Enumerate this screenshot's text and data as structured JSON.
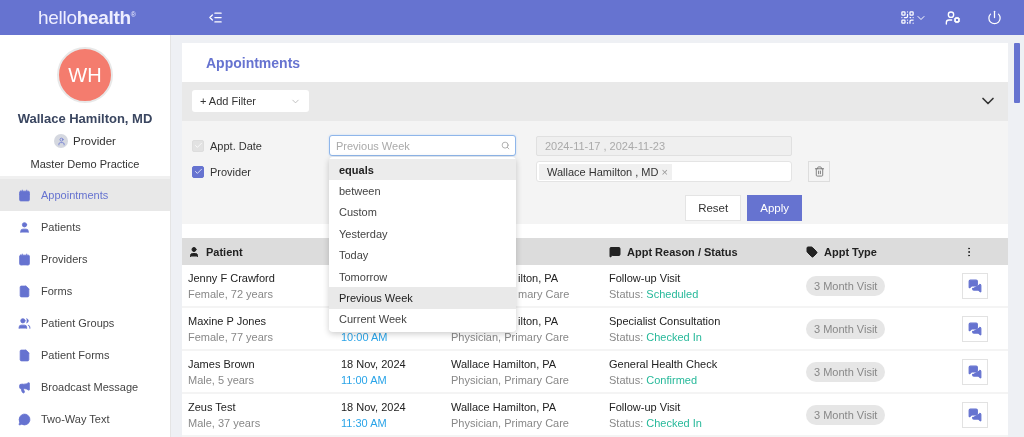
{
  "topbar": {
    "logo_light": "hello",
    "logo_bold": "health",
    "logo_mark": "®"
  },
  "profile": {
    "initials": "WH",
    "name": "Wallace Hamilton, MD",
    "role": "Provider",
    "practice": "Master Demo Practice"
  },
  "sidebar": {
    "items": [
      {
        "label": "Appointments",
        "selected": true
      },
      {
        "label": "Patients",
        "selected": false
      },
      {
        "label": "Providers",
        "selected": false
      },
      {
        "label": "Forms",
        "selected": false
      },
      {
        "label": "Patient Groups",
        "selected": false
      },
      {
        "label": "Patient Forms",
        "selected": false
      },
      {
        "label": "Broadcast Message",
        "selected": false
      },
      {
        "label": "Two-Way Text",
        "selected": false
      }
    ]
  },
  "page_title": "Appointments",
  "filter_bar": {
    "add_filter": "+ Add Filter",
    "expanded": true
  },
  "filters": [
    {
      "label": "Appt. Date",
      "checked": true,
      "disabled": true,
      "operator_placeholder": "Previous Week",
      "value": "2024-11-17 , 2024-11-23"
    },
    {
      "label": "Provider",
      "checked": true,
      "disabled": false,
      "chips": [
        "Wallace Hamilton , MD"
      ],
      "chip_remove": "×"
    }
  ],
  "buttons": {
    "reset": "Reset",
    "apply": "Apply"
  },
  "operator_dropdown": {
    "options": [
      {
        "label": "equals",
        "selected": false,
        "hovered": true
      },
      {
        "label": "between",
        "selected": false,
        "hovered": false
      },
      {
        "label": "Custom",
        "selected": false,
        "hovered": false
      },
      {
        "label": "Yesterday",
        "selected": false,
        "hovered": false
      },
      {
        "label": "Today",
        "selected": false,
        "hovered": false
      },
      {
        "label": "Tomorrow",
        "selected": false,
        "hovered": false
      },
      {
        "label": "Previous Week",
        "selected": true,
        "hovered": false
      },
      {
        "label": "Current Week",
        "selected": false,
        "hovered": false
      }
    ]
  },
  "table": {
    "columns": [
      {
        "label": "Patient"
      },
      {},
      {},
      {
        "label": "Appt Reason / Status"
      },
      {
        "label": "Appt Type"
      }
    ],
    "rows": [
      {
        "kind": "covered",
        "patient": "Jenny F Crawford",
        "details": "Female, 72 years",
        "provider": "ilton, PA",
        "specialty": "mary Care",
        "reason": "Follow-up Visit",
        "status_label": "Status:",
        "status": "Scheduled",
        "type": "3 Month Visit"
      },
      {
        "kind": "covered",
        "patient": "Maxine P Jones",
        "details": "Female, 77 years",
        "time": "10:00 AM",
        "provider": "ilton, PA",
        "specialty": "Physician, Primary Care",
        "reason": "Specialist Consultation",
        "status_label": "Status:",
        "status": "Checked In",
        "type": "3 Month Visit"
      },
      {
        "kind": "full",
        "patient": "James Brown",
        "details": "Male, 5 years",
        "date": "18 Nov, 2024",
        "time": "11:00 AM",
        "provider": "Wallace Hamilton, PA",
        "specialty": "Physician, Primary Care",
        "reason": "General Health Check",
        "status_label": "Status:",
        "status": "Confirmed",
        "type": "3 Month Visit"
      },
      {
        "kind": "full",
        "patient": "Zeus Test",
        "details": "Male, 37 years",
        "date": "18 Nov, 2024",
        "time": "11:30 AM",
        "provider": "Wallace Hamilton, PA",
        "specialty": "Physician, Primary Care",
        "reason": "Follow-up Visit",
        "status_label": "Status:",
        "status": "Checked In",
        "type": "3 Month Visit"
      }
    ]
  }
}
